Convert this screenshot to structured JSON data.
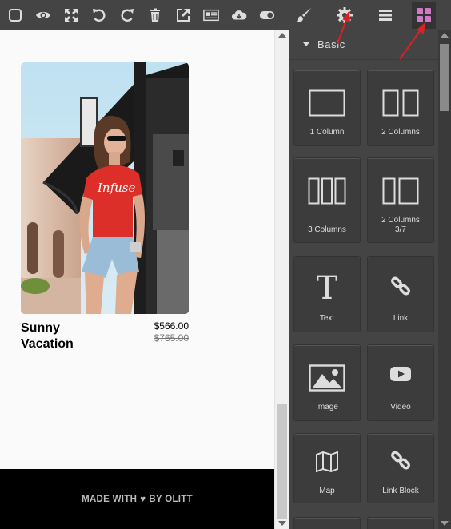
{
  "toolbar": {
    "buttons": [
      {
        "name": "sw-visibility-icon"
      },
      {
        "name": "eye-icon"
      },
      {
        "name": "fullscreen-icon"
      },
      {
        "name": "undo-icon"
      },
      {
        "name": "redo-icon"
      },
      {
        "name": "trash-icon"
      },
      {
        "name": "export-icon"
      },
      {
        "name": "newspaper-icon"
      },
      {
        "name": "cloud-download-icon"
      },
      {
        "name": "toggle-icon"
      }
    ]
  },
  "panel_tabs": [
    {
      "name": "style-manager-brush-icon"
    },
    {
      "name": "settings-gear-icon"
    },
    {
      "name": "layers-bars-icon"
    },
    {
      "name": "blocks-grid-icon",
      "active": true
    }
  ],
  "product": {
    "title_line1": "Sunny",
    "title_line2": "Vacation",
    "price": "$566.00",
    "old_price": "$765.00",
    "shirt_text": "Infuse"
  },
  "footer": {
    "prefix": "MADE WITH",
    "suffix": "BY OLITT"
  },
  "blocks": {
    "category": "Basic",
    "items": [
      {
        "label": "1 Column"
      },
      {
        "label": "2 Columns"
      },
      {
        "label": "3 Columns"
      },
      {
        "label": "2 Columns",
        "label2": "3/7"
      },
      {
        "label": "Text"
      },
      {
        "label": "Link"
      },
      {
        "label": "Image"
      },
      {
        "label": "Video"
      },
      {
        "label": "Map"
      },
      {
        "label": "Link Block"
      }
    ]
  },
  "colors": {
    "toolbar_bg": "#444444",
    "panel_bg": "#444444",
    "icon_color": "#dddddd",
    "active_icon": "#d278c9",
    "annotation": "#e02020",
    "heart": "#e0191b"
  }
}
